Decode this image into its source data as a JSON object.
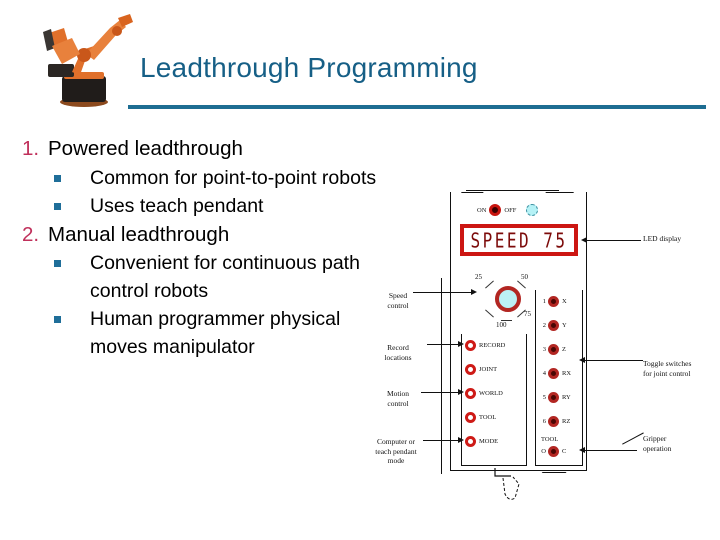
{
  "slide": {
    "title": "Leadthrough Programming",
    "title_color": "#165F86",
    "rule_color": "#1D6D92",
    "number_color": "#C0305B",
    "sub_bullet_color": "#1F6E99"
  },
  "robot_image": {
    "alt": "industrial-robot-arm",
    "body_color": "#E0702B",
    "base_color": "#201C1A"
  },
  "bullets": [
    {
      "number": "1.",
      "text": "Powered leadthrough",
      "subs": [
        "Common for point-to-point robots",
        "Uses teach pendant"
      ]
    },
    {
      "number": "2.",
      "text": "Manual leadthrough",
      "subs": [
        "Convenient for continuous path control robots",
        "Human programmer physical moves manipulator"
      ]
    }
  ],
  "pendant": {
    "lamps": {
      "on_label": "ON",
      "off_label": "OFF",
      "on_color": "#C8140F",
      "off_color": "#B6F2F6"
    },
    "led_display": {
      "value": "SPEED 75",
      "bezel_color": "#CC1612"
    },
    "speed_dial": {
      "ticks": [
        "25",
        "50",
        "75",
        "100"
      ],
      "knob_color": "#BCF0F5",
      "ring_color": "#B22622"
    },
    "left_buttons": [
      {
        "label": "RECORD"
      },
      {
        "label": "JOINT"
      },
      {
        "label": "WORLD"
      },
      {
        "label": "TOOL"
      },
      {
        "label": "MODE"
      }
    ],
    "right_buttons": [
      {
        "num": "1",
        "axis": "X"
      },
      {
        "num": "2",
        "axis": "Y"
      },
      {
        "num": "3",
        "axis": "Z"
      },
      {
        "num": "4",
        "axis": "RX"
      },
      {
        "num": "5",
        "axis": "RY"
      },
      {
        "num": "6",
        "axis": "RZ"
      }
    ],
    "tool_caption": "TOOL",
    "tool_buttons": {
      "open": "O",
      "close": "C"
    },
    "callouts": {
      "speed_control": "Speed\ncontrol",
      "record_locations": "Record\nlocations",
      "motion_control": "Motion\ncontrol",
      "mode": "Computer or\nteach pendant\nmode",
      "led_display": "LED display",
      "toggle_switches": "Toggle switches\nfor joint control",
      "gripper": "Gripper\noperation"
    }
  }
}
